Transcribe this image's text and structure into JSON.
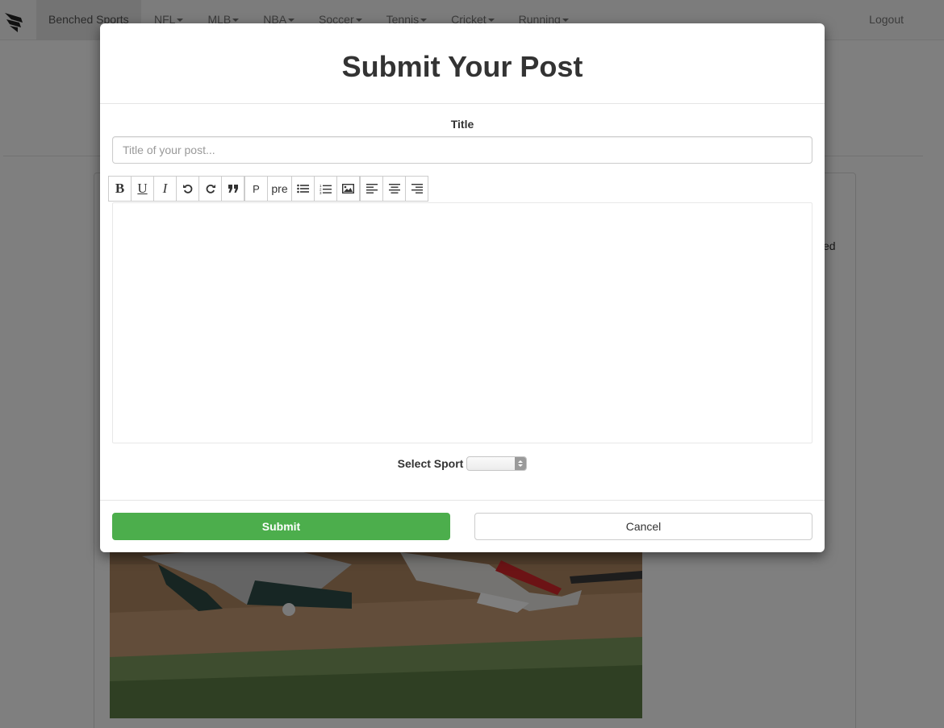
{
  "navbar": {
    "brand": "Benched Sports",
    "items": [
      {
        "label": "NFL"
      },
      {
        "label": "MLB"
      },
      {
        "label": "NBA"
      },
      {
        "label": "Soccer"
      },
      {
        "label": "Tennis"
      },
      {
        "label": "Cricket"
      },
      {
        "label": "Running"
      }
    ],
    "logout": "Logout"
  },
  "background": {
    "snippet_text": "ed"
  },
  "modal": {
    "title": "Submit Your Post",
    "title_field": {
      "label": "Title",
      "placeholder": "Title of your post...",
      "value": ""
    },
    "toolbar": {
      "bold": "B",
      "underline": "U",
      "italic": "I",
      "paragraph": "P",
      "pre": "pre"
    },
    "editor_content": "",
    "sport": {
      "label": "Select Sport",
      "selected": ""
    },
    "submit_label": "Submit",
    "cancel_label": "Cancel"
  },
  "colors": {
    "submit": "#4cae4c",
    "backdrop": "rgba(0,0,0,0.5)"
  }
}
